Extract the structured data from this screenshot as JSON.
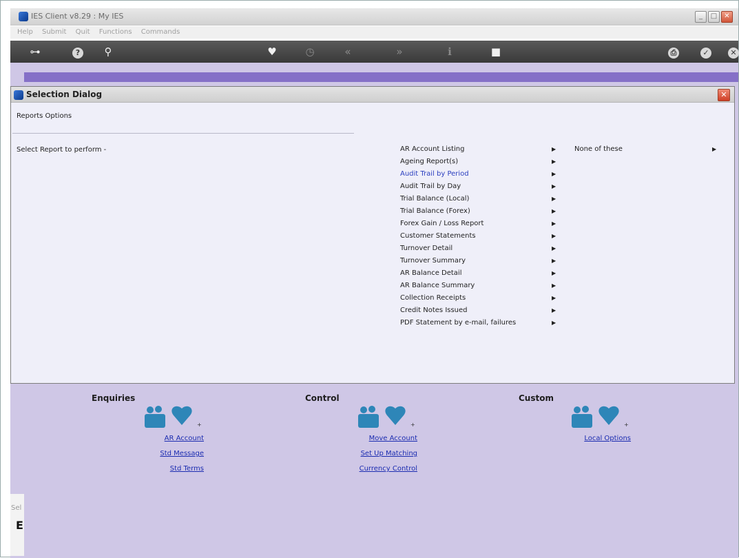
{
  "window": {
    "title": "IES Client v8.29 : My IES"
  },
  "menubar": [
    "Help",
    "Submit",
    "Quit",
    "Functions",
    "Commands"
  ],
  "toolbar_icons": [
    "key-icon",
    "help-icon",
    "search-icon",
    "heart-icon",
    "clock-icon",
    "back-icon",
    "forward-icon",
    "info-icon",
    "stop-icon",
    "print-icon",
    "ok-icon",
    "close-icon"
  ],
  "dialog": {
    "title": "Selection Dialog",
    "subtitle": "Reports Options",
    "prompt": "Select Report to perform -",
    "items": [
      "AR Account Listing",
      "Ageing Report(s)",
      "Audit Trail by Period",
      "Audit Trail by Day",
      "Trial Balance (Local)",
      "Trial Balance (Forex)",
      "Forex Gain / Loss Report",
      "Customer Statements",
      "Turnover Detail",
      "Turnover Summary",
      "AR Balance Detail",
      "AR Balance Summary",
      "Collection Receipts",
      "Credit Notes Issued",
      "PDF Statement by e-mail, failures"
    ],
    "active_index": 2,
    "submenu": "None of these"
  },
  "panels": {
    "enquiries": {
      "title": "Enquiries",
      "links": [
        "AR Account",
        "Std Message",
        "Std Terms"
      ]
    },
    "control": {
      "title": "Control",
      "links": [
        "Move Account",
        "Set Up Matching",
        "Currency Control"
      ]
    },
    "custom": {
      "title": "Custom",
      "links": [
        "Local Options"
      ]
    }
  },
  "strip": {
    "label": "Sel",
    "letter": "E"
  },
  "colors": {
    "accent_purple": "#8570c7",
    "panel_lavender": "#cfc7e6",
    "link_blue": "#1a2bb0",
    "active_blue": "#2b3fbf",
    "icon_teal": "#2e86b8"
  }
}
